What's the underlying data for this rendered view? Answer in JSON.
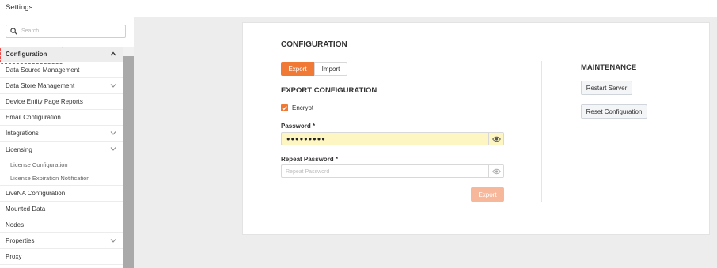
{
  "app": {
    "title": "Settings"
  },
  "search": {
    "placeholder": "Search..."
  },
  "sidebar": {
    "items": [
      {
        "label": "Configuration",
        "active": true,
        "chevron": "up"
      },
      {
        "label": "Data Source Management"
      },
      {
        "label": "Data Store Management",
        "chevron": "down"
      },
      {
        "label": "Device Entity Page Reports"
      },
      {
        "label": "Email Configuration"
      },
      {
        "label": "Integrations",
        "chevron": "down"
      },
      {
        "label": "Licensing",
        "chevron": "down"
      },
      {
        "label": "License Configuration",
        "sub": true
      },
      {
        "label": "License Expiration Notification",
        "sub": true
      },
      {
        "label": "LiveNA Configuration"
      },
      {
        "label": "Mounted Data"
      },
      {
        "label": "Nodes"
      },
      {
        "label": "Properties",
        "chevron": "down"
      },
      {
        "label": "Proxy"
      }
    ]
  },
  "main": {
    "title": "CONFIGURATION",
    "tabs": [
      {
        "label": "Export",
        "active": true
      },
      {
        "label": "Import",
        "active": false
      }
    ],
    "export_title": "EXPORT CONFIGURATION",
    "encrypt": {
      "label": "Encrypt",
      "checked": true
    },
    "password": {
      "label": "Password *",
      "value": "●●●●●●●●●"
    },
    "repeat_password": {
      "label": "Repeat Password *",
      "placeholder": "Repeat Password",
      "value": ""
    },
    "export_button": "Export"
  },
  "maintenance": {
    "title": "MAINTENANCE",
    "restart_button": "Restart Server",
    "reset_button": "Reset Configuration"
  },
  "colors": {
    "accent": "#f07a35",
    "accent_disabled": "#f7b79a",
    "autofill": "#fdf6c2",
    "background": "#ededed"
  },
  "icons": [
    "search-icon",
    "chevron-up-icon",
    "chevron-down-icon",
    "checkbox-check-icon",
    "eye-icon"
  ]
}
